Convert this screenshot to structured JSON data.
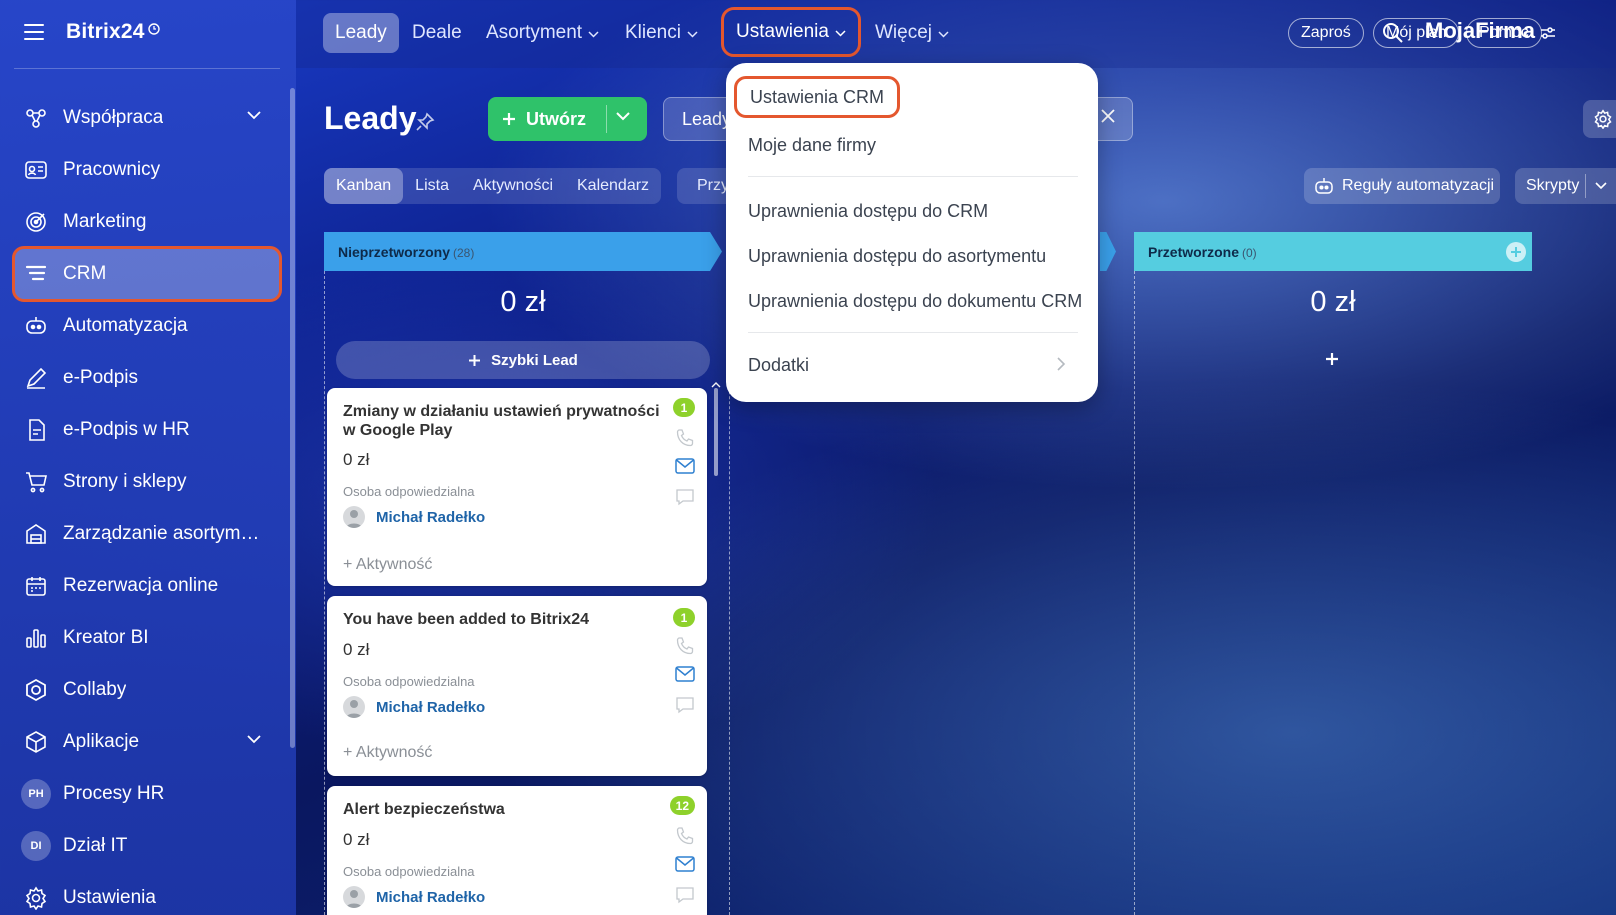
{
  "sidebar": {
    "brand": "Bitrix24",
    "items": [
      {
        "label": "Współpraca",
        "icon": "collaboration-icon"
      },
      {
        "label": "Pracownicy",
        "icon": "employees-icon"
      },
      {
        "label": "Marketing",
        "icon": "marketing-icon"
      },
      {
        "label": "CRM",
        "icon": "crm-icon"
      },
      {
        "label": "Automatyzacja",
        "icon": "automation-icon"
      },
      {
        "label": "e-Podpis",
        "icon": "signature-icon"
      },
      {
        "label": "e-Podpis w HR",
        "icon": "hr-signature-icon"
      },
      {
        "label": "Strony i sklepy",
        "icon": "cart-icon"
      },
      {
        "label": "Zarządzanie asortymen...",
        "icon": "inventory-icon"
      },
      {
        "label": "Rezerwacja online",
        "icon": "calendar-booking-icon"
      },
      {
        "label": "Kreator BI",
        "icon": "bi-chart-icon"
      },
      {
        "label": "Collaby",
        "icon": "collaby-icon"
      },
      {
        "label": "Aplikacje",
        "icon": "apps-icon"
      },
      {
        "label": "Procesy HR",
        "avatar": "PH"
      },
      {
        "label": "Dział IT",
        "avatar": "DI"
      },
      {
        "label": "Ustawienia",
        "icon": "settings-gear-icon"
      }
    ]
  },
  "topnav": {
    "items": [
      "Leady",
      "Deale",
      "Asortyment",
      "Klienci",
      "Ustawienia",
      "Więcej"
    ],
    "company": "MojaFirma",
    "pills": [
      "Zaproś",
      "Mój plan",
      "Pomoc"
    ]
  },
  "page": {
    "title": "Leady",
    "create_label": "Utwórz",
    "filter_value": "Leady"
  },
  "views": {
    "tabs": [
      "Kanban",
      "Lista",
      "Aktywności",
      "Kalendarz"
    ],
    "more": "Przy",
    "automation_label": "Reguły automatyzacji",
    "scripts_label": "Skrypty"
  },
  "kanban": {
    "columns": [
      {
        "name": "Nieprzetworzony",
        "count": "(28)",
        "sum": "0 zł"
      },
      {
        "name": "Przetworzone",
        "count": "(0)",
        "sum": "0 zł"
      }
    ],
    "quick_lead": "Szybki Lead",
    "cards": [
      {
        "title": "Zmiany w działaniu ustawień prywatności w Google Play",
        "amount": "0 zł",
        "resp_label": "Osoba odpowiedzialna",
        "person": "Michał Radełko",
        "activity": "+ Aktywność",
        "badge": "1"
      },
      {
        "title": "You have been added to Bitrix24",
        "amount": "0 zł",
        "resp_label": "Osoba odpowiedzialna",
        "person": "Michał Radełko",
        "activity": "+ Aktywność",
        "badge": "1"
      },
      {
        "title": "Alert bezpieczeństwa",
        "amount": "0 zł",
        "resp_label": "Osoba odpowiedzialna",
        "person": "Michał Radełko",
        "activity": "",
        "badge": "12"
      }
    ]
  },
  "dropdown": {
    "items": [
      "Ustawienia CRM",
      "Moje dane firmy",
      "Uprawnienia dostępu do CRM",
      "Uprawnienia dostępu do asortymentu",
      "Uprawnienia dostępu do dokumentu CRM",
      "Dodatki"
    ]
  },
  "colors": {
    "accent_outline": "#e4572e",
    "create_button": "#2fc26a",
    "column1_header": "#3aa0ea",
    "column2_header": "#55cde0",
    "badge": "#8ed12b",
    "link": "#1f64a8"
  }
}
